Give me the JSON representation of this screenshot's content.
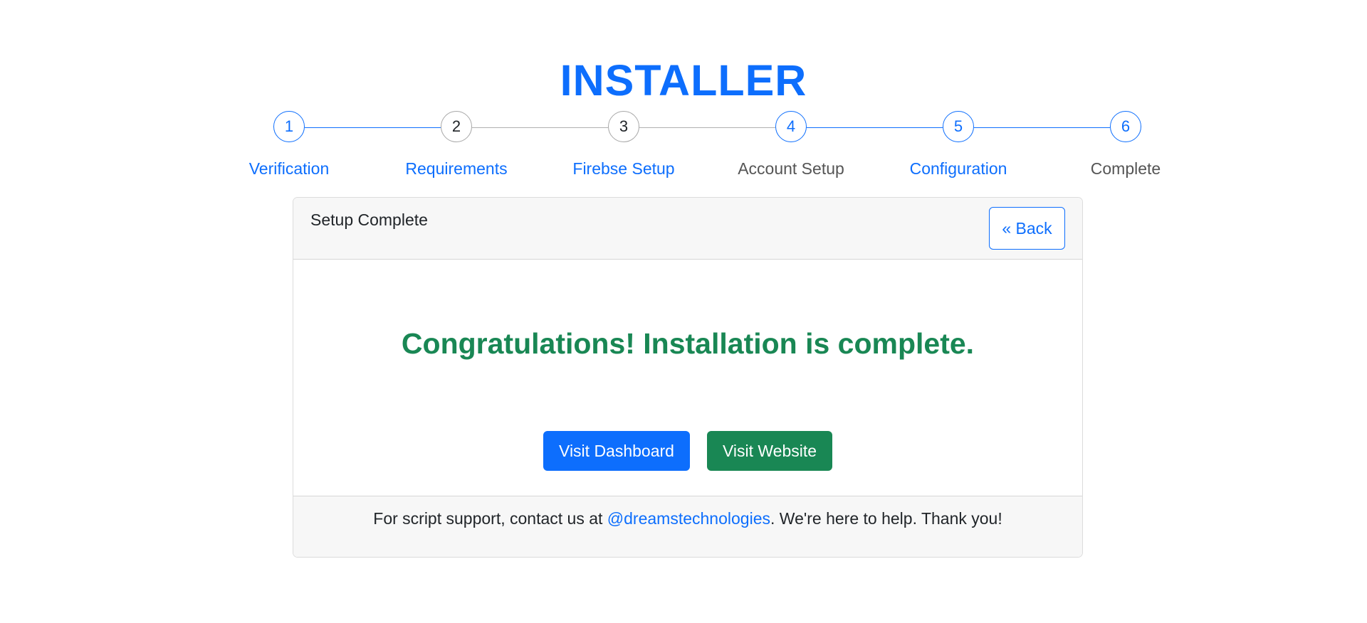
{
  "header": {
    "title": "INSTALLER"
  },
  "steps": [
    {
      "number": "1",
      "label": "Verification",
      "state": "active"
    },
    {
      "number": "2",
      "label": "Requirements",
      "state": "active"
    },
    {
      "number": "3",
      "label": "Firebse Setup",
      "state": "active"
    },
    {
      "number": "4",
      "label": "Account Setup",
      "state": "inactive"
    },
    {
      "number": "5",
      "label": "Configuration",
      "state": "active"
    },
    {
      "number": "6",
      "label": "Complete",
      "state": "inactive"
    }
  ],
  "card": {
    "title": "Setup Complete",
    "back_label": "« Back",
    "message": "Congratulations! Installation is complete.",
    "dashboard_label": "Visit Dashboard",
    "website_label": "Visit Website"
  },
  "footer": {
    "prefix": "For script support, contact us at ",
    "link": "@dreamstechnologies",
    "suffix": ". We're here to help. Thank you!"
  },
  "colors": {
    "accent": "#0d6efd",
    "success": "#198754",
    "muted_text": "#555555"
  }
}
